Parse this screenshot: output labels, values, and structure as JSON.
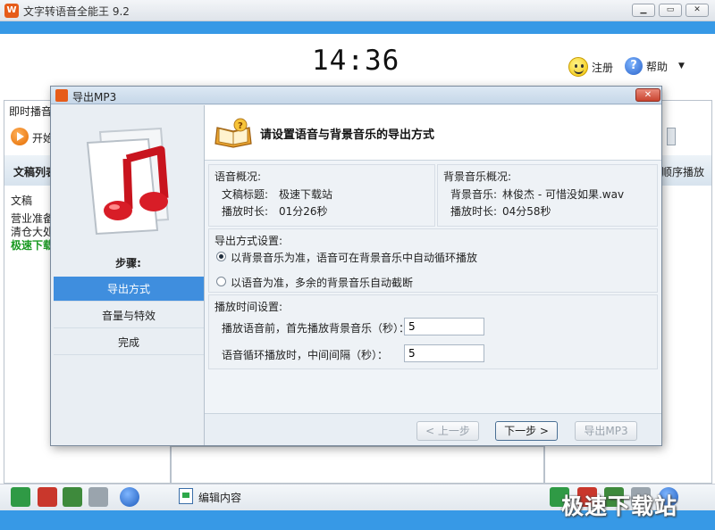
{
  "app": {
    "title": "文字转语音全能王 9.2",
    "clock": "14:36",
    "register_label": "注册",
    "help_label": "帮助",
    "window_controls": [
      "minimize",
      "restore",
      "close"
    ]
  },
  "background": {
    "realtime_tab": "即时播音",
    "start_label": "开始",
    "doc_list_header": "文稿列表",
    "doc_list_col": "文稿",
    "doc_items": [
      "营业准备",
      "清仓大处",
      "极速下载"
    ],
    "order_play_label": "顺序播放",
    "edit_label": "编辑内容",
    "watermark": "极速下载站"
  },
  "dialog": {
    "title": "导出MP3",
    "heading": "请设置语音与背景音乐的导出方式",
    "steps_title": "步骤:",
    "steps": [
      "导出方式",
      "音量与特效",
      "完成"
    ],
    "active_step": 0,
    "voice_overview": {
      "title": "语音概况:",
      "doc_title_label": "文稿标题:",
      "doc_title_value": "极速下载站",
      "duration_label": "播放时长:",
      "duration_value": "01分26秒"
    },
    "bgm_overview": {
      "title": "背景音乐概况:",
      "music_label": "背景音乐:",
      "music_value": "林俊杰 - 可惜没如果.wav",
      "duration_label": "播放时长:",
      "duration_value": "04分58秒"
    },
    "export_mode": {
      "title": "导出方式设置:",
      "options": [
        {
          "label": "以背景音乐为准，语音可在背景音乐中自动循环播放",
          "checked": true
        },
        {
          "label": "以语音为准，多余的背景音乐自动截断",
          "checked": false
        }
      ]
    },
    "timing": {
      "title": "播放时间设置:",
      "pre_label": "播放语音前，首先播放背景音乐（秒）：",
      "pre_value": "5",
      "interval_label": "语音循环播放时，中间间隔（秒）：",
      "interval_value": "5"
    },
    "buttons": {
      "prev": "< 上一步",
      "next": "下一步 >",
      "export": "导出MP3"
    }
  },
  "colors": {
    "accent_blue": "#3799e6",
    "active_step": "#3f8ede",
    "close_red": "#c94430"
  }
}
